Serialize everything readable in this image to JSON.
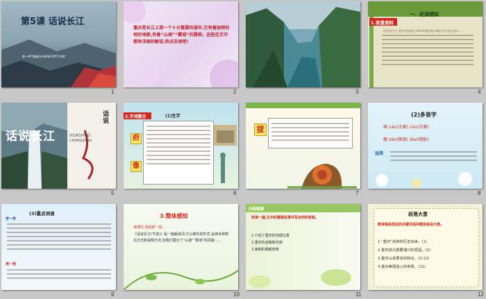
{
  "slides": [
    {
      "num": "1",
      "title": "第5课  话说长江",
      "subtitle": "第一PPT模板网-WWW.1PPT.COM"
    },
    {
      "num": "2",
      "text": "重庆是长江上游一个十分重要的城市,它有着独特的地形地貌,有着“山城”“雾城”的雅称。这些在文中都有详细的解说,快点去读吧!"
    },
    {
      "num": "3"
    },
    {
      "num": "4",
      "label": "1.背景资料",
      "heading": "一、初读感知",
      "note_text": "《话说长江》是中央电视台1983年推出的25集大型文化纪录片……"
    },
    {
      "num": "5",
      "calligraphy": "话说长江",
      "pinyin1": "HUASHUO",
      "pinyin2": "CHANGJIANG",
      "vert": "话说"
    },
    {
      "num": "6",
      "label": "2.字词整合",
      "subtitle": "(1)生字",
      "chars": [
        "府",
        "像"
      ]
    },
    {
      "num": "7",
      "char": "拔"
    },
    {
      "num": "8",
      "heading": "(2)多音字",
      "lines": [
        "难 nán(灾难) nàn(灾难)",
        "朝 dǎo(倒退) dào(倒影)"
      ],
      "usage": "运用"
    },
    {
      "num": "9",
      "heading": "(3)重点词语",
      "sub": "学一学",
      "tag": "用一用"
    },
    {
      "num": "10",
      "heading": "3.整体感知",
      "lead": "读课文,说说前一段。",
      "body": "《话说长江(节选)》是一篇解说词,它以聊天的形式,运用多种表达方式和说明方法,向我们展示了“山城”“雾城”的风貌……"
    },
    {
      "num": "11",
      "heading": "内容梳理",
      "lead": "快读一遍,文中的重要段落并写出你的答案。",
      "items": [
        "1.介绍了重庆的地理位置",
        "2.重庆的道路和交通",
        "3.美丽的雾都夜景"
      ]
    },
    {
      "num": "12",
      "heading": "段落大意",
      "lead": "默读每段前后的关键词语并概括各段大意。",
      "items": [
        "1.“重庆”名称的历史由来。(1)",
        "2.重庆成为重要港口的原因。(2)",
        "3.重庆山多雾多的特点。(3-13)",
        "4.重庆美丽迷人的夜景。(22)"
      ]
    }
  ],
  "colors": {
    "accent_red": "#d22020",
    "accent_green": "#6ab23c",
    "panel_bg": "#c8c8c8"
  }
}
